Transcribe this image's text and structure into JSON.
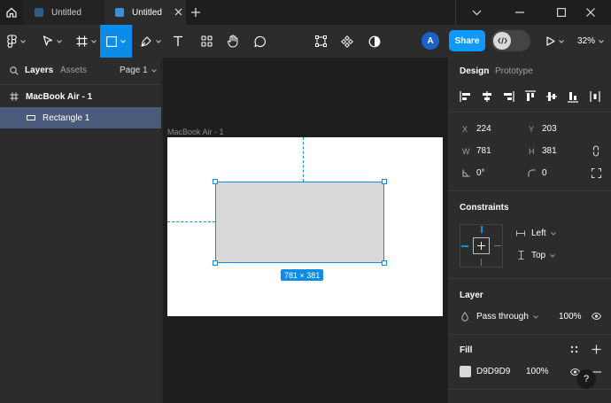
{
  "tabs": [
    {
      "label": "Untitled",
      "active": false
    },
    {
      "label": "Untitled",
      "active": true
    }
  ],
  "toolbar": {
    "avatar_initial": "A",
    "share_label": "Share",
    "zoom_label": "32%"
  },
  "layers_panel": {
    "tab_layers": "Layers",
    "tab_assets": "Assets",
    "page_label": "Page 1",
    "frame_name": "MacBook Air - 1",
    "rect_name": "Rectangle 1"
  },
  "canvas": {
    "frame_label": "MacBook Air - 1",
    "size_badge": "781 × 381"
  },
  "design_panel": {
    "tab_design": "Design",
    "tab_prototype": "Prototype",
    "x_label": "X",
    "x_value": "224",
    "y_label": "Y",
    "y_value": "203",
    "w_label": "W",
    "w_value": "781",
    "h_label": "H",
    "h_value": "381",
    "rotation_value": "0°",
    "radius_value": "0",
    "constraints_title": "Constraints",
    "constraint_h": "Left",
    "constraint_v": "Top",
    "layer_title": "Layer",
    "blend_mode": "Pass through",
    "layer_opacity": "100%",
    "fill_title": "Fill",
    "fill_hex": "D9D9D9",
    "fill_opacity": "100%",
    "fill_color": "#d9d9d9",
    "help_label": "?"
  },
  "colors": {
    "accent": "#0c8ce9",
    "share": "#0d99ff",
    "selected_layer": "#4a5a7a"
  }
}
